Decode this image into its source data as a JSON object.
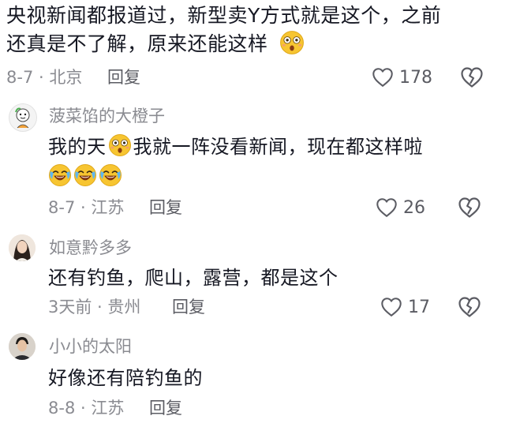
{
  "root": {
    "text_line1": "央视新闻都报道过，新型卖Y方式就是这个，之前",
    "text_line2": "还真是不了解，原来还能这样",
    "meta": "8-7 · 北京",
    "reply_label": "回复",
    "likes": "178",
    "emoji": "shocked-face-emoji"
  },
  "replies": [
    {
      "username": "菠菜馅的大橙子",
      "text_a": "我的天",
      "text_b": "我就一阵没看新闻，现在都这样啦",
      "emojis": [
        "shocked-face-emoji",
        "crying-laughing-emoji",
        "crying-laughing-emoji",
        "crying-laughing-emoji"
      ],
      "meta": "8-7 · 江苏",
      "reply_label": "回复",
      "likes": "26"
    },
    {
      "username": "如意黔多多",
      "text": "还有钓鱼，爬山，露营，都是这个",
      "meta": "3天前 · 贵州",
      "reply_label": "回复",
      "likes": "17"
    },
    {
      "username": "小小的太阳",
      "text": "好像还有陪钓鱼的",
      "meta": "8-8 · 江苏",
      "reply_label": "回复"
    }
  ],
  "colors": {
    "primary_text": "#161823",
    "secondary_text": "#8a8b91",
    "icon": "#5b5c63",
    "emoji_yellow": "#f7c531"
  }
}
